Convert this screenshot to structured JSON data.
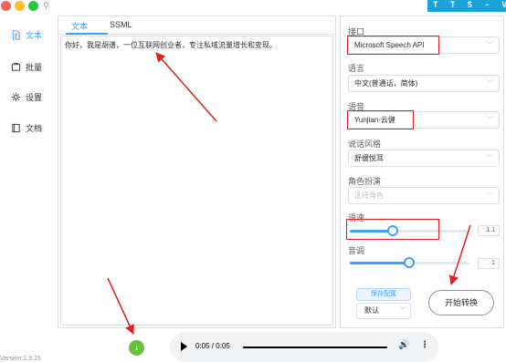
{
  "brand": "T T S - V U E",
  "sidebar": {
    "items": [
      {
        "label": "文本",
        "icon": "document-icon"
      },
      {
        "label": "批量",
        "icon": "folder-icon"
      },
      {
        "label": "设置",
        "icon": "gear-icon"
      },
      {
        "label": "文档",
        "icon": "book-icon"
      }
    ],
    "version": "Version:1.9.15"
  },
  "editor": {
    "tabs": [
      "文本",
      "SSML"
    ],
    "text": "你好，我是胡谱，一位互联网创业者，专注私域流量增长和变现。"
  },
  "settings": {
    "api_label": "接口",
    "api_value": "Microsoft Speech API",
    "language_label": "语言",
    "language_value": "中文(普通话，简体)",
    "voice_label": "语音",
    "voice_value": "Yunjian-云健",
    "style_label": "说话风格",
    "style_value": "舒缓悦耳",
    "role_label": "角色扮演",
    "role_placeholder": "选择角色",
    "rate_label": "语速",
    "rate_value": "1.1",
    "rate_fraction": 0.36,
    "pitch_label": "音调",
    "pitch_value": "1",
    "pitch_fraction": 0.5,
    "save_label": "保存配置",
    "preset_value": "默认",
    "start_label": "开始转换"
  },
  "player": {
    "time": "0:05 / 0:05",
    "progress_fraction": 1.0
  },
  "colors": {
    "accent": "#409eff",
    "annotation": "#e02020",
    "download": "#67c23a",
    "brand": "#1aa3d9"
  }
}
